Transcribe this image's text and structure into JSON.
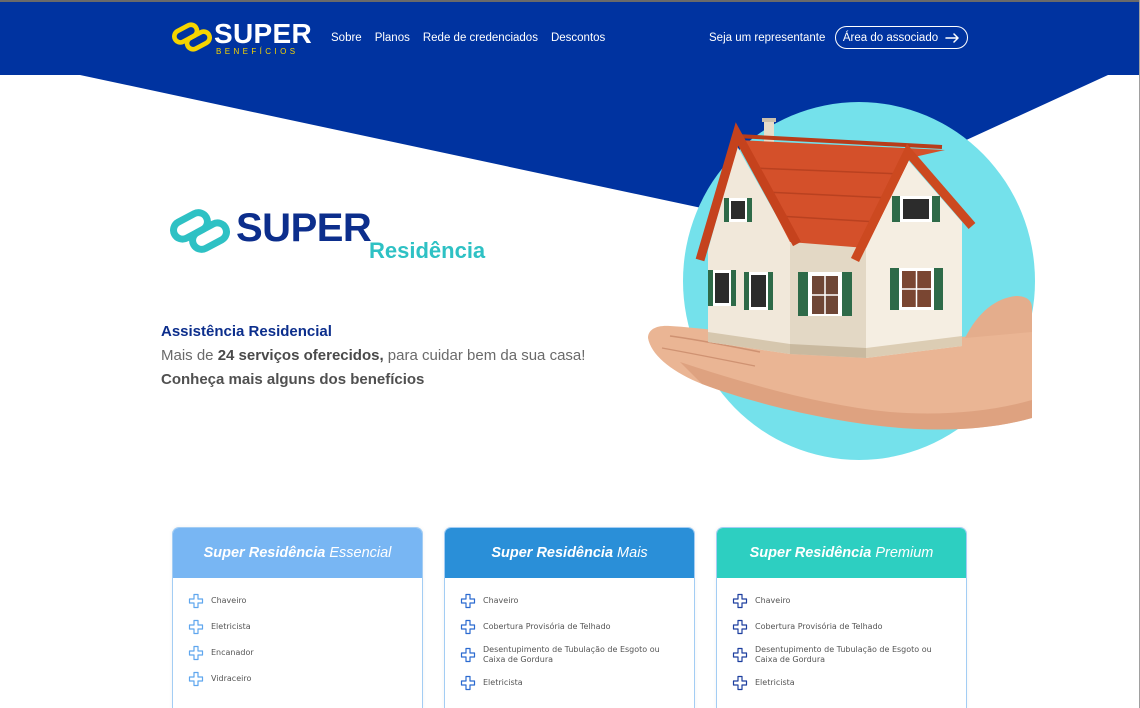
{
  "colors": {
    "navy": "#0033a0",
    "accent_yellow": "#f5d400",
    "teal": "#2ec1c4",
    "hero_circle": "#74e1eb",
    "heading_navy": "#0c2e8c"
  },
  "header": {
    "logo": {
      "text": "SUPER",
      "tagline": "BENEFÍCIOS",
      "icon": "super-chain-logo-icon"
    },
    "nav": [
      {
        "label": "Sobre"
      },
      {
        "label": "Planos"
      },
      {
        "label": "Rede de credenciados"
      },
      {
        "label": "Descontos"
      }
    ],
    "representative_link": "Seja um representante",
    "member_area_button": {
      "label": "Área do associado",
      "icon": "arrow-right-icon"
    }
  },
  "hero": {
    "logo": {
      "text": "SUPER",
      "subtitle": "Residência",
      "icon": "super-chain-logo-icon"
    },
    "heading": "Assistência Residencial",
    "description": {
      "prefix": "Mais de ",
      "highlight": "24 serviços oferecidos,",
      "suffix": " para cuidar bem da sua casa!"
    },
    "cta_text": "Conheça mais alguns dos benefícios",
    "image": "house-on-hand-illustration"
  },
  "plans": [
    {
      "title_bold": "Super Residência",
      "title_light": "Essencial",
      "header_color": "#78b6f3",
      "icon_color": "#5fa6ee",
      "item_icon": "plus-icon",
      "items": [
        "Chaveiro",
        "Eletricista",
        "Encanador",
        "Vidraceiro"
      ]
    },
    {
      "title_bold": "Super Residência",
      "title_light": "Mais",
      "header_color": "#2a8fd8",
      "icon_color": "#2b6ad0",
      "item_icon": "plus-icon",
      "items": [
        "Chaveiro",
        "Cobertura Provisória de Telhado",
        "Desentupimento de Tubulação de Esgoto ou Caixa de Gordura",
        "Eletricista"
      ]
    },
    {
      "title_bold": "Super Residência",
      "title_light": "Premium",
      "header_color": "#2dcfc1",
      "icon_color": "#1d3f9f",
      "item_icon": "plus-icon",
      "items": [
        "Chaveiro",
        "Cobertura Provisória de Telhado",
        "Desentupimento de Tubulação de Esgoto ou Caixa de Gordura",
        "Eletricista"
      ]
    }
  ]
}
